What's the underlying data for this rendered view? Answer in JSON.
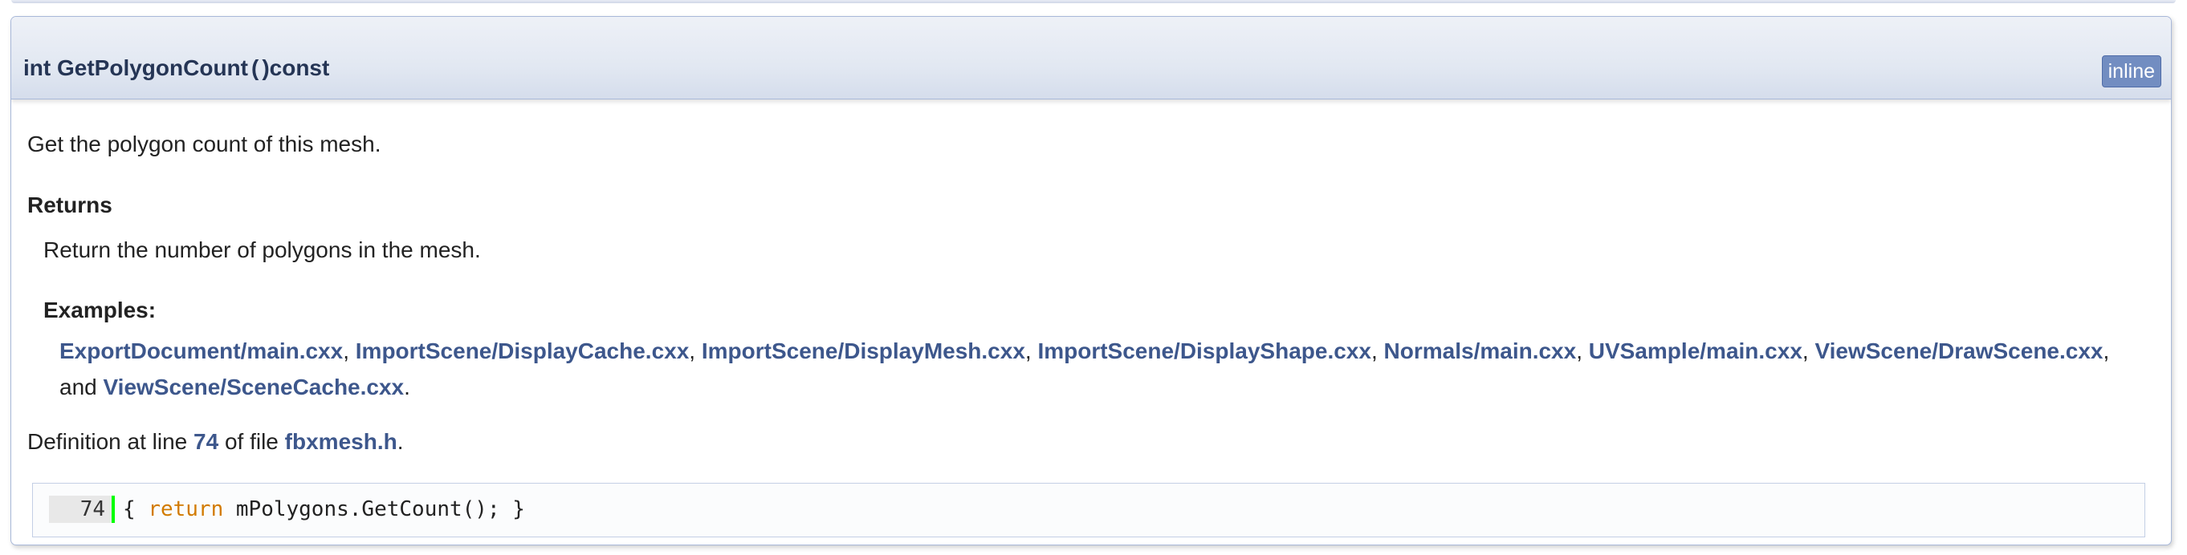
{
  "prototype": {
    "return_type": "int",
    "name": "GetPolygonCount",
    "open_paren": "(",
    "close_paren": ")",
    "qualifier": "const",
    "badge": "inline"
  },
  "doc": {
    "brief": "Get the polygon count of this mesh.",
    "returns_title": "Returns",
    "returns_text": "Return the number of polygons in the mesh.",
    "examples_title": "Examples:",
    "examples": [
      "ExportDocument/main.cxx",
      "ImportScene/DisplayCache.cxx",
      "ImportScene/DisplayMesh.cxx",
      "ImportScene/DisplayShape.cxx",
      "Normals/main.cxx",
      "UVSample/main.cxx",
      "ViewScene/DrawScene.cxx",
      "ViewScene/SceneCache.cxx"
    ],
    "examples_and": "and",
    "definition_prefix": "Definition at line",
    "definition_line": "74",
    "definition_mid": "of file",
    "definition_file": "fbxmesh.h",
    "definition_end": "."
  },
  "code_fragment": {
    "line_number": "74",
    "open_brace": "{ ",
    "keyword": "return",
    "body": " mPolygons.GetCount(); }"
  },
  "colors": {
    "link": "#3d578c",
    "keyword": "#d27b00",
    "badge_bg": "#728dc1",
    "line_marker": "#00ff00"
  }
}
